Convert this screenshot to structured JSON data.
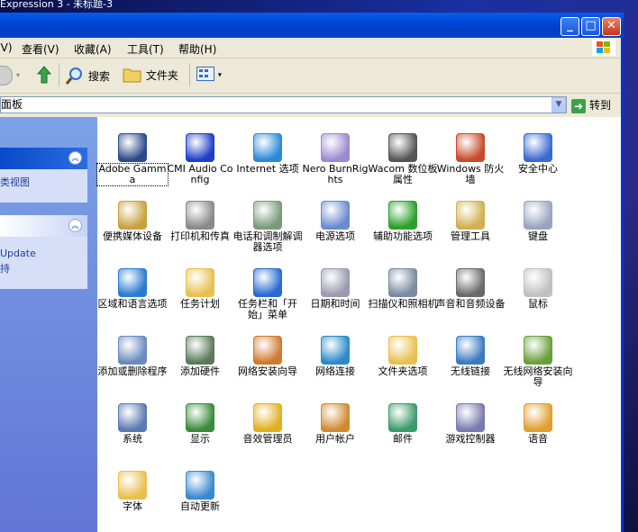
{
  "desktop": {
    "bg_text": "Expression 3 - 未标题-3"
  },
  "window": {
    "buttons": {
      "minimize": "_",
      "maximize": "□",
      "close": "✕"
    }
  },
  "menu": {
    "items": [
      "看(V)",
      "查看(V)",
      "收藏(A)",
      "工具(T)",
      "帮助(H)"
    ]
  },
  "toolbar": {
    "search_label": "搜索",
    "folders_label": "文件夹"
  },
  "address": {
    "value": "面板",
    "go_label": "转到"
  },
  "sidebar": {
    "panel1_link": "类视图",
    "panel2_links": [
      "Update",
      "持"
    ]
  },
  "items": [
    {
      "label": "Adobe Gamma",
      "icon": "monitor-icon",
      "color": "#2c4a8a"
    },
    {
      "label": "CMI Audio Config",
      "icon": "xear3d-icon",
      "color": "#1f3fc8"
    },
    {
      "label": "Internet 选项",
      "icon": "globe-icon",
      "color": "#2a8ad8"
    },
    {
      "label": "Nero BurnRights",
      "icon": "cd-lock-icon",
      "color": "#9a8ad0"
    },
    {
      "label": "Wacom 数位板属性",
      "icon": "tablet-icon",
      "color": "#555555"
    },
    {
      "label": "Windows 防火墙",
      "icon": "firewall-icon",
      "color": "#c84a2a"
    },
    {
      "label": "安全中心",
      "icon": "shield-icon",
      "color": "#3a6ad0"
    },
    {
      "label": "便携媒体设备",
      "icon": "media-device-icon",
      "color": "#c8a040"
    },
    {
      "label": "打印机和传真",
      "icon": "printer-icon",
      "color": "#8a8a8a"
    },
    {
      "label": "电话和调制解调器选项",
      "icon": "phone-icon",
      "color": "#7a9a7a"
    },
    {
      "label": "电源选项",
      "icon": "power-icon",
      "color": "#6a8ad0"
    },
    {
      "label": "辅助功能选项",
      "icon": "accessibility-icon",
      "color": "#2aa02a"
    },
    {
      "label": "管理工具",
      "icon": "admin-tools-icon",
      "color": "#d0b050"
    },
    {
      "label": "键盘",
      "icon": "keyboard-icon",
      "color": "#9aa4c0"
    },
    {
      "label": "区域和语言选项",
      "icon": "globe-region-icon",
      "color": "#2a7ad0"
    },
    {
      "label": "任务计划",
      "icon": "folder-clock-icon",
      "color": "#e8c050"
    },
    {
      "label": "任务栏和「开始」菜单",
      "icon": "taskbar-icon",
      "color": "#2a6ad0"
    },
    {
      "label": "日期和时间",
      "icon": "calendar-icon",
      "color": "#9a9ab0"
    },
    {
      "label": "扫描仪和照相机",
      "icon": "scanner-icon",
      "color": "#7a8aa0"
    },
    {
      "label": "声音和音频设备",
      "icon": "speaker-icon",
      "color": "#6a6a6a"
    },
    {
      "label": "鼠标",
      "icon": "mouse-icon",
      "color": "#c0c0c0"
    },
    {
      "label": "添加或删除程序",
      "icon": "add-remove-icon",
      "color": "#6a8ac0"
    },
    {
      "label": "添加硬件",
      "icon": "hardware-icon",
      "color": "#5a7a5a"
    },
    {
      "label": "网络安装向导",
      "icon": "network-home-icon",
      "color": "#d07a30"
    },
    {
      "label": "网络连接",
      "icon": "network-globe-icon",
      "color": "#2a8ac8"
    },
    {
      "label": "文件夹选项",
      "icon": "folder-options-icon",
      "color": "#e8c050"
    },
    {
      "label": "无线链接",
      "icon": "wireless-link-icon",
      "color": "#3a7ac0"
    },
    {
      "label": "无线网络安装向导",
      "icon": "wireless-usb-icon",
      "color": "#6aa03a"
    },
    {
      "label": "系统",
      "icon": "system-icon",
      "color": "#5a7ab0"
    },
    {
      "label": "显示",
      "icon": "display-icon",
      "color": "#3a8a3a"
    },
    {
      "label": "音效管理员",
      "icon": "sound-manager-icon",
      "color": "#e0b020"
    },
    {
      "label": "用户帐户",
      "icon": "users-icon",
      "color": "#d08a30"
    },
    {
      "label": "邮件",
      "icon": "mail-icon",
      "color": "#3a9a6a"
    },
    {
      "label": "游戏控制器",
      "icon": "gamepad-icon",
      "color": "#7a7ab0"
    },
    {
      "label": "语音",
      "icon": "speech-icon",
      "color": "#e0a030"
    },
    {
      "label": "字体",
      "icon": "fonts-folder-icon",
      "color": "#e8c050"
    },
    {
      "label": "自动更新",
      "icon": "windows-update-icon",
      "color": "#3a8ad0"
    }
  ]
}
